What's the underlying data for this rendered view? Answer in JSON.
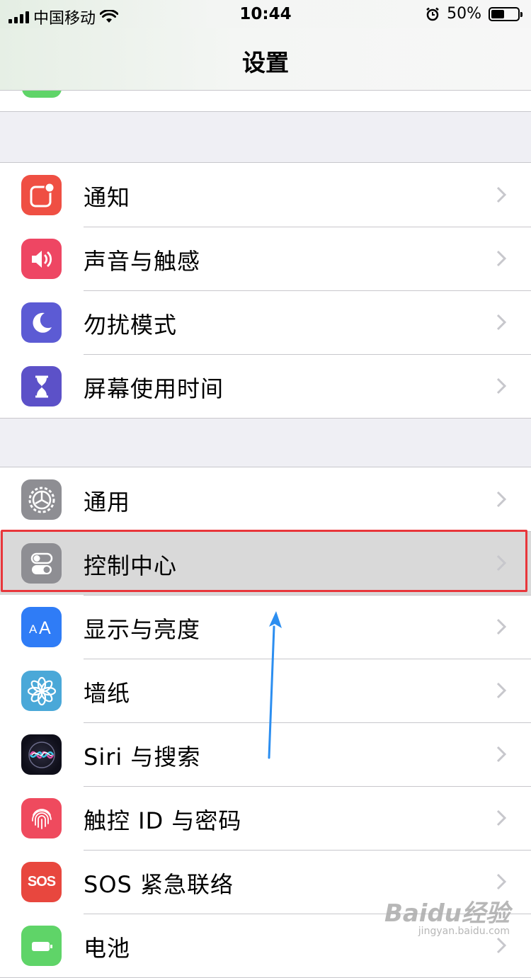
{
  "status_bar": {
    "carrier": "中国移动",
    "time": "10:44",
    "battery": "50%",
    "battery_level": 0.5,
    "icons": [
      "signal-icon",
      "wifi-icon",
      "alarm-icon",
      "battery-icon"
    ]
  },
  "nav": {
    "title": "设置"
  },
  "groups": [
    {
      "items": [
        {
          "label": "通知",
          "icon": "notification-icon",
          "color": "#ef4f43"
        },
        {
          "label": "声音与触感",
          "icon": "speaker-icon",
          "color": "#ee4663"
        },
        {
          "label": "勿扰模式",
          "icon": "moon-icon",
          "color": "#5c5bd4"
        },
        {
          "label": "屏幕使用时间",
          "icon": "hourglass-icon",
          "color": "#5c51c8"
        }
      ]
    },
    {
      "items": [
        {
          "label": "通用",
          "icon": "gear-icon",
          "color": "#8e8e93"
        },
        {
          "label": "控制中心",
          "icon": "toggles-icon",
          "color": "#8e8e93"
        },
        {
          "label": "显示与亮度",
          "icon": "text-size-icon",
          "color": "#2f7cf6"
        },
        {
          "label": "墙纸",
          "icon": "flower-icon",
          "color": "#4aa8d8"
        },
        {
          "label": "Siri 与搜索",
          "icon": "siri-icon",
          "color": "#1c1c2e"
        },
        {
          "label": "触控 ID 与密码",
          "icon": "fingerprint-icon",
          "color": "#ef4a5e"
        },
        {
          "label": "SOS 紧急联络",
          "icon_text": "SOS",
          "icon": "sos-icon",
          "color": "#e8473e"
        },
        {
          "label": "电池",
          "icon": "battery-green-icon",
          "color": "#5fd468"
        }
      ]
    }
  ],
  "watermark": {
    "brand": "Baidu经验",
    "url": "jingyan.baidu.com"
  },
  "colors": {
    "highlight_border": "#e8363b",
    "arrow": "#2c8ef0",
    "chevron": "#c7c7cc"
  }
}
